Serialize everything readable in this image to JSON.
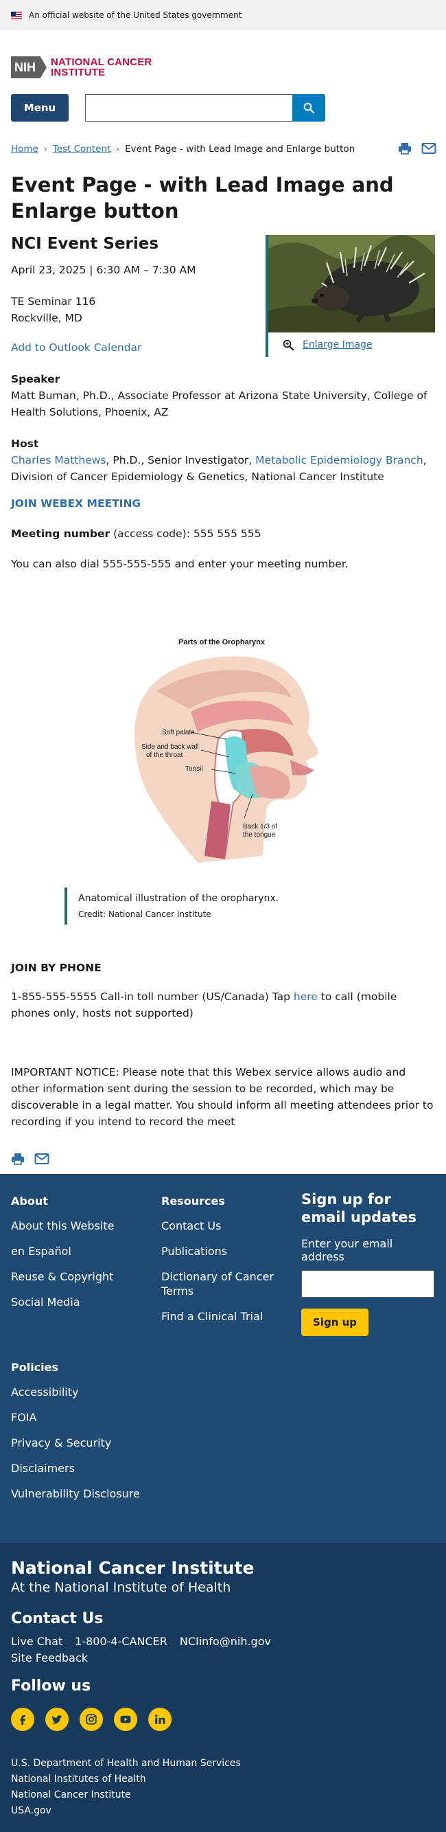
{
  "gov_banner": {
    "text": "An official website of the United States government"
  },
  "header": {
    "logo_mark": "NIH",
    "logo_line1": "NATIONAL CANCER",
    "logo_line2": "INSTITUTE",
    "menu_label": "Menu",
    "search_value": ""
  },
  "breadcrumb": {
    "items": [
      "Home",
      "Test Content"
    ],
    "current": "Event Page - with Lead Image and Enlarge button"
  },
  "page": {
    "title": "Event Page - with Lead Image and Enlarge button",
    "series": "NCI Event Series",
    "datetime": "April 23, 2025 | 6:30 AM – 7:30 AM",
    "location_line1": "TE Seminar 116",
    "location_line2": "Rockville, MD",
    "outlook_link": "Add to Outlook Calendar",
    "enlarge_label": "Enlarge Image",
    "speaker_heading": "Speaker",
    "speaker_text": "Matt Buman, Ph.D., Associate Professor at Arizona State University, College of Health Solutions, Phoenix, AZ",
    "host_heading": "Host",
    "host_name": "Charles Matthews",
    "host_mid": ", Ph.D., Senior Investigator, ",
    "host_branch": "Metabolic Epidemiology Branch",
    "host_tail": ", Division of Cancer Epidemiology & Genetics, National Cancer Institute",
    "webex_link": "JOIN WEBEX MEETING",
    "meeting_label": "Meeting number",
    "meeting_text": " (access code): 555 555 555",
    "dial_text": "You can also dial 555-555-555 and enter your meeting number.",
    "figure": {
      "title": "Parts of the Oropharynx",
      "label_soft_palate": "Soft palate",
      "label_side_wall_1": "Side and back wall",
      "label_side_wall_2": "of the throat",
      "label_tonsil": "Tonsil",
      "label_tongue_1": "Back 1/3 of",
      "label_tongue_2": "the tongue",
      "caption": "Anatomical illustration of the oropharynx.",
      "credit": "Credit: National Cancer Institute"
    },
    "phone_heading": "JOIN BY PHONE",
    "phone_text_before": "1-855-555-5555 Call-in toll number (US/Canada) Tap ",
    "phone_link": "here",
    "phone_text_after": " to call (mobile phones only, hosts not supported)",
    "notice": "IMPORTANT NOTICE: Please note that this Webex service allows audio and other information sent during the session to be recorded, which may be discoverable in a legal matter. You should inform all meeting attendees prior to recording if you intend to record the meet"
  },
  "footer": {
    "about_heading": "About",
    "about_links": [
      "About this Website",
      "en Español",
      "Reuse & Copyright",
      "Social Media"
    ],
    "resources_heading": "Resources",
    "resources_links": [
      "Contact Us",
      "Publications",
      "Dictionary of Cancer Terms",
      "Find a Clinical Trial"
    ],
    "signup_heading": "Sign up for email updates",
    "signup_label": "Enter your email address",
    "signup_button": "Sign up",
    "policies_heading": "Policies",
    "policies_links": [
      "Accessibility",
      "FOIA",
      "Privacy & Security",
      "Disclaimers",
      "Vulnerability Disclosure"
    ],
    "nci_title": "National Cancer Institute",
    "nci_sub": "At the National Institute of Health",
    "contact_heading": "Contact Us",
    "contact_live_chat": "Live Chat",
    "contact_phone": "1-800-4-CANCER",
    "contact_email": "NCIinfo@nih.gov",
    "site_feedback": "Site Feedback",
    "follow_heading": "Follow us",
    "social_icons": [
      "facebook-icon",
      "twitter-icon",
      "instagram-icon",
      "youtube-icon",
      "linkedin-icon"
    ],
    "agencies": [
      "U.S. Department of Health and Human Services",
      "National Institutes of Health",
      "National Cancer Institute",
      "USA.gov"
    ]
  },
  "colors": {
    "brand_red": "#bb0e3d",
    "menu_navy": "#1f4671",
    "search_blue": "#007bbd",
    "link_blue": "#2e6fa7",
    "accent_teal": "#1f6c6a",
    "footer_top": "#1f4a73",
    "footer_bottom": "#163a5e",
    "button_yellow": "#fdc601"
  }
}
